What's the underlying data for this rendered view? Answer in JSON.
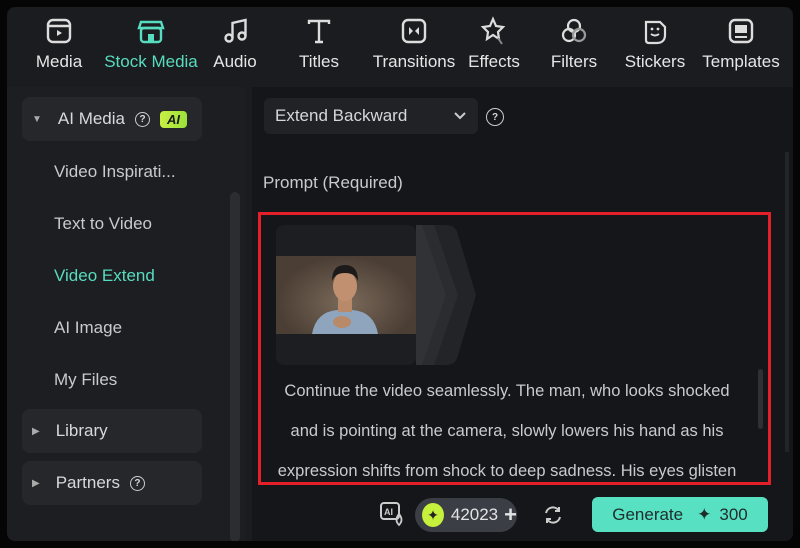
{
  "toolbar": {
    "items": [
      {
        "label": "Media",
        "icon": "media-icon"
      },
      {
        "label": "Stock Media",
        "icon": "stock-media-icon",
        "active": true
      },
      {
        "label": "Audio",
        "icon": "music-note-icon"
      },
      {
        "label": "Titles",
        "icon": "text-t-icon"
      },
      {
        "label": "Transitions",
        "icon": "transitions-icon"
      },
      {
        "label": "Effects",
        "icon": "effects-star-icon"
      },
      {
        "label": "Filters",
        "icon": "filters-icon"
      },
      {
        "label": "Stickers",
        "icon": "sticker-icon"
      },
      {
        "label": "Templates",
        "icon": "templates-icon"
      }
    ]
  },
  "sidebar": {
    "ai_media": {
      "label": "AI Media",
      "badge": "AI"
    },
    "items": [
      {
        "label": "Video Inspirati..."
      },
      {
        "label": "Text to Video"
      },
      {
        "label": "Video Extend",
        "active": true
      },
      {
        "label": "AI Image"
      },
      {
        "label": "My Files"
      }
    ],
    "library": {
      "label": "Library"
    },
    "partners": {
      "label": "Partners"
    }
  },
  "main": {
    "mode_select": "Extend Backward",
    "prompt_label": "Prompt (Required)",
    "prompt_text": "Continue the video seamlessly. The man, who looks shocked and is pointing at the camera, slowly lowers his hand as his expression shifts from shock to deep sadness. His eyes glisten"
  },
  "footer": {
    "credits": "42023",
    "generate_label": "Generate",
    "generate_cost": "300"
  },
  "colors": {
    "accent": "#58dcc0",
    "highlight": "#e3202a",
    "ai_badge": "#c5f03b"
  }
}
